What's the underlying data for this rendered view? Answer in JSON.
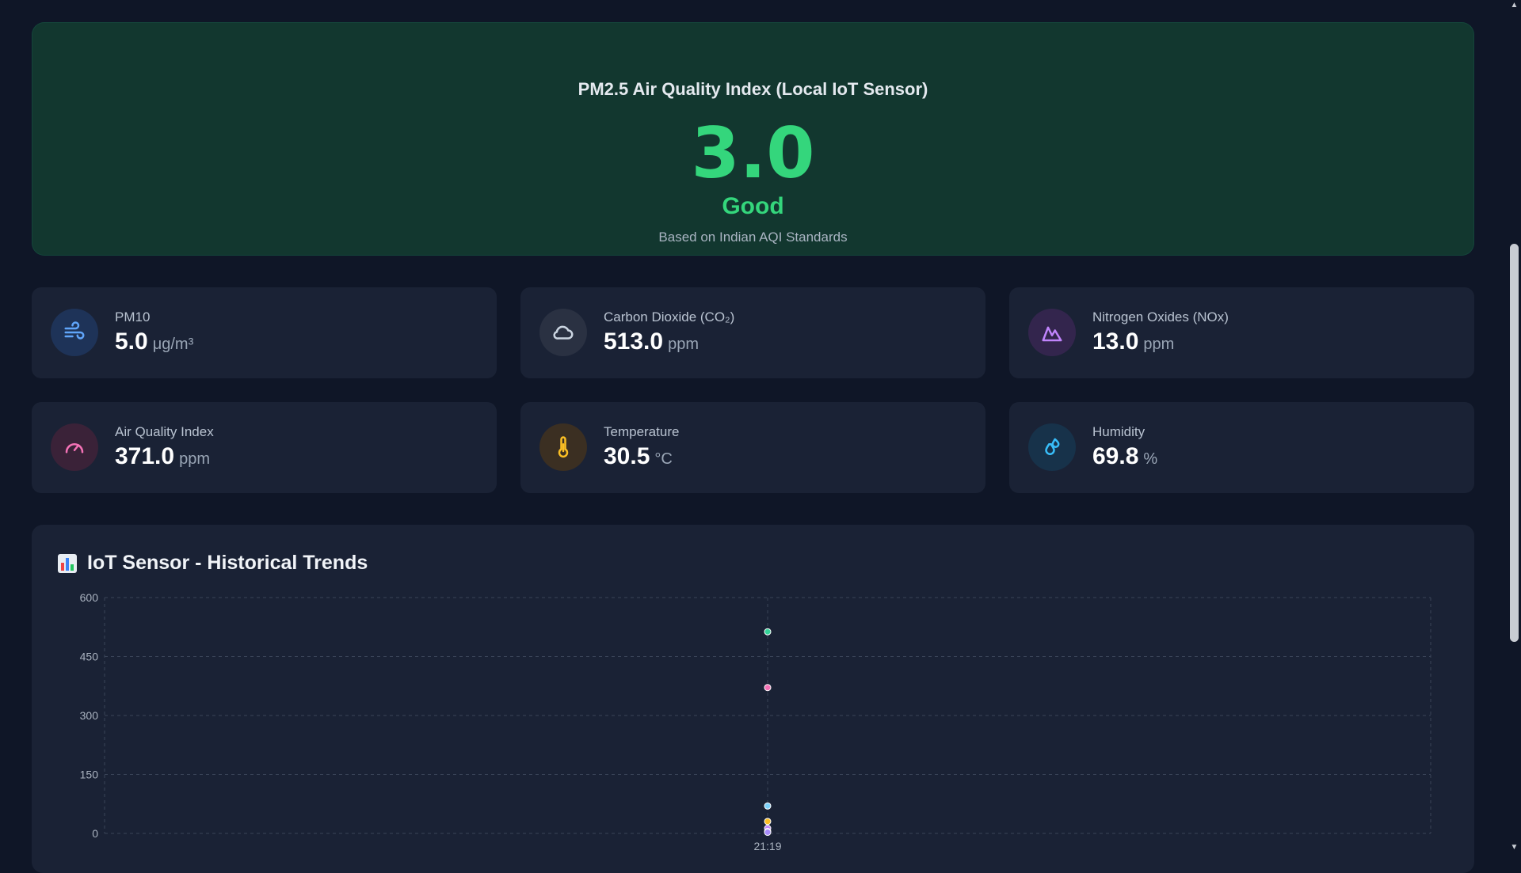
{
  "hero": {
    "title": "PM2.5 Air Quality Index (Local IoT Sensor)",
    "value": "3.0",
    "status": "Good",
    "subtitle": "Based on Indian AQI Standards",
    "accent": "#34d67c"
  },
  "cards": [
    {
      "label": "PM10",
      "value": "5.0",
      "unit": "μg/m³",
      "icon": "wind-icon",
      "color": "#60a5fa"
    },
    {
      "label": "Carbon Dioxide (CO₂)",
      "value": "513.0",
      "unit": "ppm",
      "icon": "cloud-icon",
      "color": "#cbd5e1"
    },
    {
      "label": "Nitrogen Oxides (NOx)",
      "value": "13.0",
      "unit": "ppm",
      "icon": "mountain-icon",
      "color": "#c084fc"
    },
    {
      "label": "Air Quality Index",
      "value": "371.0",
      "unit": "ppm",
      "icon": "gauge-icon",
      "color": "#f472b6"
    },
    {
      "label": "Temperature",
      "value": "30.5",
      "unit": "°C",
      "icon": "thermometer-icon",
      "color": "#fbbf24"
    },
    {
      "label": "Humidity",
      "value": "69.8",
      "unit": "%",
      "icon": "droplets-icon",
      "color": "#38bdf8"
    }
  ],
  "chart": {
    "title": "IoT Sensor - Historical Trends",
    "icon": "bar-chart-icon"
  },
  "chart_data": {
    "type": "scatter",
    "x": [
      "21:19"
    ],
    "ylim": [
      0,
      600
    ],
    "yticks": [
      0,
      150,
      300,
      450,
      600
    ],
    "grid": true,
    "series": [
      {
        "values": [
          513
        ],
        "color": "#34d399"
      },
      {
        "values": [
          371
        ],
        "color": "#f472b6"
      },
      {
        "values": [
          69.8
        ],
        "color": "#7dd3fc"
      },
      {
        "values": [
          30.5
        ],
        "color": "#fbbf24"
      },
      {
        "values": [
          13
        ],
        "color": "#c084fc"
      },
      {
        "values": [
          5
        ],
        "color": "#60a5fa"
      },
      {
        "values": [
          3
        ],
        "color": "#a78bfa"
      }
    ]
  }
}
